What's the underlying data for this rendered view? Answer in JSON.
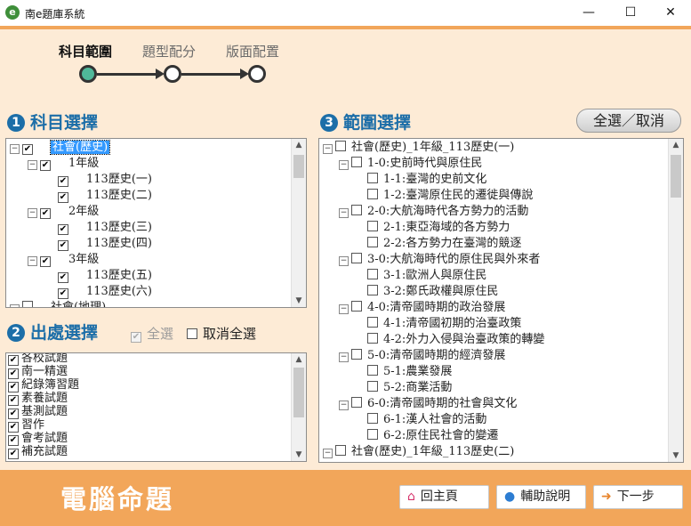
{
  "window": {
    "title": "南e題庫系統",
    "minimize": "—",
    "maximize": "☐",
    "close": "✕"
  },
  "wizard": {
    "steps": [
      {
        "label": "科目範圍"
      },
      {
        "label": "題型配分"
      },
      {
        "label": "版面配置"
      }
    ]
  },
  "subject": {
    "num": "1",
    "title": "科目選擇",
    "tree": [
      {
        "label": "社會(歷史)",
        "level": 0
      },
      {
        "label": "1年級",
        "level": 1
      },
      {
        "label": "113歷史(一)",
        "level": 2
      },
      {
        "label": "113歷史(二)",
        "level": 2
      },
      {
        "label": "2年級",
        "level": 1
      },
      {
        "label": "113歷史(三)",
        "level": 2
      },
      {
        "label": "113歷史(四)",
        "level": 2
      },
      {
        "label": "3年級",
        "level": 1
      },
      {
        "label": "113歷史(五)",
        "level": 2
      },
      {
        "label": "113歷史(六)",
        "level": 2
      },
      {
        "label": "社會(地理)",
        "level": 0
      }
    ]
  },
  "source": {
    "num": "2",
    "title": "出處選擇",
    "select_all": "全選",
    "deselect_all": "取消全選",
    "items": [
      "各校試題",
      "南一精選",
      "紀錄簿習題",
      "素養試題",
      "基測試題",
      "習作",
      "會考試題",
      "補充試題"
    ]
  },
  "range": {
    "num": "3",
    "title": "範圍選擇",
    "toggle_label": "全選／取消",
    "tree": [
      {
        "label": "社會(歷史)_1年級_113歷史(一)",
        "level": 0
      },
      {
        "label": "1-0:史前時代與原住民",
        "level": 1
      },
      {
        "label": "1-1:臺灣的史前文化",
        "level": 2
      },
      {
        "label": "1-2:臺灣原住民的遷徙與傳說",
        "level": 2
      },
      {
        "label": "2-0:大航海時代各方勢力的活動",
        "level": 1
      },
      {
        "label": "2-1:東亞海域的各方勢力",
        "level": 2
      },
      {
        "label": "2-2:各方勢力在臺灣的競逐",
        "level": 2
      },
      {
        "label": "3-0:大航海時代的原住民與外來者",
        "level": 1
      },
      {
        "label": "3-1:歐洲人與原住民",
        "level": 2
      },
      {
        "label": "3-2:鄭氏政權與原住民",
        "level": 2
      },
      {
        "label": "4-0:清帝國時期的政治發展",
        "level": 1
      },
      {
        "label": "4-1:清帝國初期的治臺政策",
        "level": 2
      },
      {
        "label": "4-2:外力入侵與治臺政策的轉變",
        "level": 2
      },
      {
        "label": "5-0:清帝國時期的經濟發展",
        "level": 1
      },
      {
        "label": "5-1:農業發展",
        "level": 2
      },
      {
        "label": "5-2:商業活動",
        "level": 2
      },
      {
        "label": "6-0:清帝國時期的社會與文化",
        "level": 1
      },
      {
        "label": "6-1:漢人社會的活動",
        "level": 2
      },
      {
        "label": "6-2:原住民社會的變遷",
        "level": 2
      },
      {
        "label": "社會(歷史)_1年級_113歷史(二)",
        "level": 0
      }
    ]
  },
  "footer": {
    "title": "電腦命題",
    "home_label": "回主頁",
    "help_label": "輔助說明",
    "next_label": "下一步"
  },
  "colors": {
    "accent": "#F2A65A",
    "section_title": "#1C6EA8",
    "background": "#FDEBD6",
    "step_active": "#4FB89A"
  }
}
